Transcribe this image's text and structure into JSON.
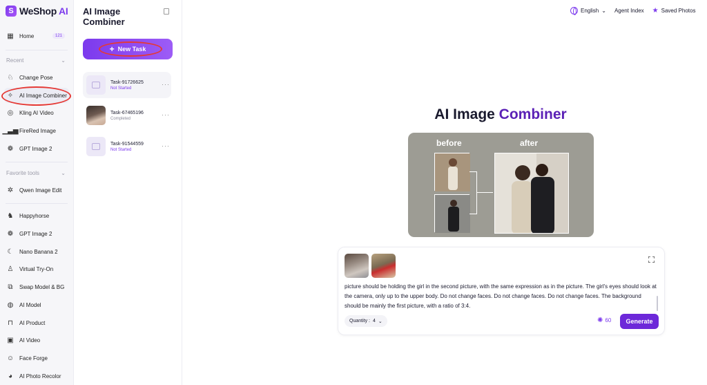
{
  "brand": {
    "name_prefix": "WeShop",
    "name_suffix": "AI"
  },
  "nav": {
    "home": {
      "label": "Home",
      "badge": "121"
    },
    "recent_label": "Recent",
    "recent": [
      "Change Pose",
      "AI Image Combiner",
      "Kling AI Video",
      "FireRed Image",
      "GPT Image 2"
    ],
    "favorites_label": "Favorite tools",
    "favorites": [
      "Qwen Image Edit"
    ],
    "tools": [
      "Happyhorse",
      "GPT Image 2",
      "Nano Banana 2",
      "Virtual Try-On",
      "Swap Model & BG",
      "AI Model",
      "AI Product",
      "AI Video",
      "Face Forge",
      "AI Photo Recolor"
    ]
  },
  "panel": {
    "title": "AI Image Combiner",
    "new_task": "New Task",
    "tasks": [
      {
        "name": "Task-91726625",
        "status": "Not Started"
      },
      {
        "name": "Task-67465196",
        "status": "Completed"
      },
      {
        "name": "Task-91544559",
        "status": "Not Started"
      }
    ]
  },
  "topbar": {
    "language": "English",
    "agent_index": "Agent Index",
    "saved_photos": "Saved Photos"
  },
  "hero": {
    "title_plain": "AI Image",
    "title_accent": "Combiner",
    "before_label": "before",
    "after_label": "after"
  },
  "prompt": {
    "text": "picture should be holding the girl in the second picture, with the same expression as in the picture. The girl's eyes should look at the camera, only up to the upper body. Do not change faces. Do not change faces. Do not change faces. The background should be mainly the first picture, with a ratio of 3:4.",
    "quantity_label": "Quantity :",
    "quantity_value": "4",
    "credits": "60",
    "generate": "Generate"
  },
  "colors": {
    "accent": "#7c3aed",
    "annotation": "#e53935"
  }
}
